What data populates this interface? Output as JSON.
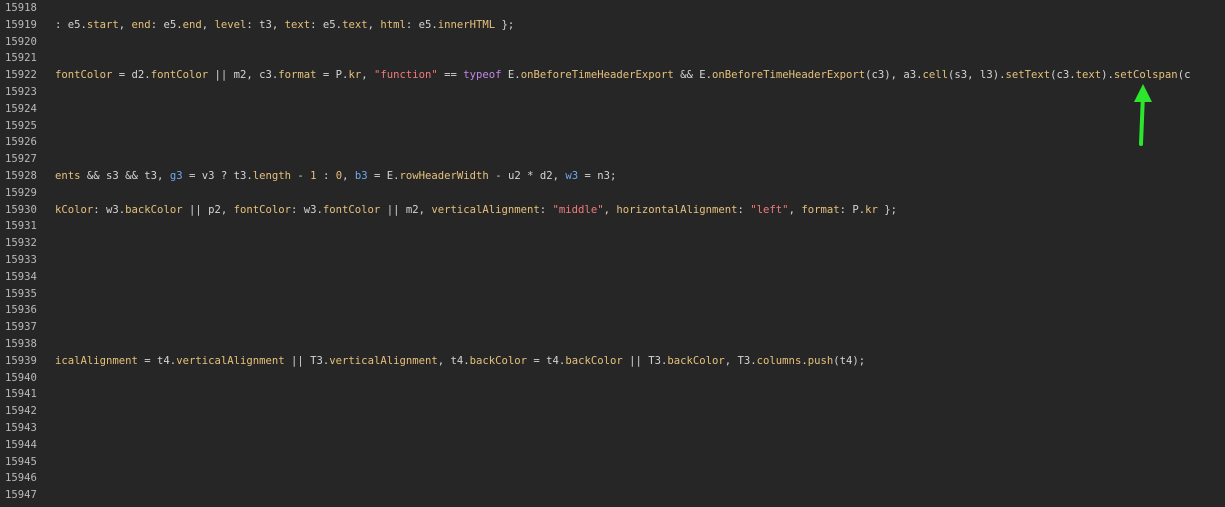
{
  "lines": [
    {
      "no": "15918"
    },
    {
      "no": "15919",
      "t": [
        [
          ": e5.",
          "p"
        ],
        [
          "start",
          "y"
        ],
        [
          ", ",
          "p"
        ],
        [
          "end",
          "y"
        ],
        [
          ": e5.",
          "p"
        ],
        [
          "end",
          "y"
        ],
        [
          ", ",
          "p"
        ],
        [
          "level",
          "y"
        ],
        [
          ": t3, ",
          "p"
        ],
        [
          "text",
          "y"
        ],
        [
          ": e5.",
          "p"
        ],
        [
          "text",
          "y"
        ],
        [
          ", ",
          "p"
        ],
        [
          "html",
          "y"
        ],
        [
          ": e5.",
          "p"
        ],
        [
          "innerHTML",
          "y"
        ],
        [
          " };",
          "p"
        ]
      ]
    },
    {
      "no": "15920"
    },
    {
      "no": "15921"
    },
    {
      "no": "15922",
      "t": [
        [
          "fontColor",
          "y"
        ],
        [
          " = d2.",
          "p"
        ],
        [
          "fontColor",
          "y"
        ],
        [
          " || m2, c3.",
          "p"
        ],
        [
          "format",
          "y"
        ],
        [
          " = P.",
          "p"
        ],
        [
          "kr",
          "y"
        ],
        [
          ", ",
          "p"
        ],
        [
          "\"function\"",
          "s"
        ],
        [
          " == ",
          "p"
        ],
        [
          "typeof",
          "k"
        ],
        [
          " E.",
          "p"
        ],
        [
          "onBeforeTimeHeaderExport",
          "y"
        ],
        [
          " && E.",
          "p"
        ],
        [
          "onBeforeTimeHeaderExport",
          "y"
        ],
        [
          "(c3), a3.",
          "p"
        ],
        [
          "cell",
          "y"
        ],
        [
          "(s3, l3).",
          "p"
        ],
        [
          "setText",
          "y"
        ],
        [
          "(c3.",
          "p"
        ],
        [
          "text",
          "y"
        ],
        [
          ").",
          "p"
        ],
        [
          "setColspan",
          "y"
        ],
        [
          "(c",
          "p"
        ]
      ]
    },
    {
      "no": "15923"
    },
    {
      "no": "15924"
    },
    {
      "no": "15925"
    },
    {
      "no": "15926"
    },
    {
      "no": "15927"
    },
    {
      "no": "15928",
      "t": [
        [
          "ents",
          "y"
        ],
        [
          " && s3 && t3, ",
          "p"
        ],
        [
          "g3",
          "b"
        ],
        [
          " = v3 ? t3.",
          "p"
        ],
        [
          "length",
          "y"
        ],
        [
          " - ",
          "p"
        ],
        [
          "1",
          "y"
        ],
        [
          " : ",
          "p"
        ],
        [
          "0",
          "y"
        ],
        [
          ", ",
          "p"
        ],
        [
          "b3",
          "b"
        ],
        [
          " = E.",
          "p"
        ],
        [
          "rowHeaderWidth",
          "y"
        ],
        [
          " - u2 * d2, ",
          "p"
        ],
        [
          "w3",
          "b"
        ],
        [
          " = n3;",
          "p"
        ]
      ]
    },
    {
      "no": "15929"
    },
    {
      "no": "15930",
      "t": [
        [
          "kColor",
          "y"
        ],
        [
          ": w3.",
          "p"
        ],
        [
          "backColor",
          "y"
        ],
        [
          " || p2, ",
          "p"
        ],
        [
          "fontColor",
          "y"
        ],
        [
          ": w3.",
          "p"
        ],
        [
          "fontColor",
          "y"
        ],
        [
          " || m2, ",
          "p"
        ],
        [
          "verticalAlignment",
          "y"
        ],
        [
          ": ",
          "p"
        ],
        [
          "\"middle\"",
          "s"
        ],
        [
          ", ",
          "p"
        ],
        [
          "horizontalAlignment",
          "y"
        ],
        [
          ": ",
          "p"
        ],
        [
          "\"left\"",
          "s"
        ],
        [
          ", ",
          "p"
        ],
        [
          "format",
          "y"
        ],
        [
          ": P.",
          "p"
        ],
        [
          "kr",
          "y"
        ],
        [
          " };",
          "p"
        ]
      ]
    },
    {
      "no": "15931"
    },
    {
      "no": "15932"
    },
    {
      "no": "15933"
    },
    {
      "no": "15934"
    },
    {
      "no": "15935"
    },
    {
      "no": "15936"
    },
    {
      "no": "15937"
    },
    {
      "no": "15938"
    },
    {
      "no": "15939",
      "t": [
        [
          "icalAlignment",
          "y"
        ],
        [
          " = t4.",
          "p"
        ],
        [
          "verticalAlignment",
          "y"
        ],
        [
          " || T3.",
          "p"
        ],
        [
          "verticalAlignment",
          "y"
        ],
        [
          ", t4.",
          "p"
        ],
        [
          "backColor",
          "y"
        ],
        [
          " = t4.",
          "p"
        ],
        [
          "backColor",
          "y"
        ],
        [
          " || T3.",
          "p"
        ],
        [
          "backColor",
          "y"
        ],
        [
          ", T3.",
          "p"
        ],
        [
          "columns",
          "y"
        ],
        [
          ".",
          "p"
        ],
        [
          "push",
          "y"
        ],
        [
          "(t4);",
          "p"
        ]
      ]
    },
    {
      "no": "15940"
    },
    {
      "no": "15941"
    },
    {
      "no": "15942"
    },
    {
      "no": "15943"
    },
    {
      "no": "15944"
    },
    {
      "no": "15945"
    },
    {
      "no": "15946"
    },
    {
      "no": "15947"
    }
  ],
  "colors": {
    "background": "#262627",
    "line_number": "#b9b9b9",
    "punctuation": "#d4d4d4",
    "property": "#e5c07b",
    "string": "#f07a7a",
    "keyword": "#c586e8",
    "variable_decl": "#6ea8f0",
    "arrow": "#2ee52e"
  },
  "annotation": {
    "icon": "up-arrow-icon"
  }
}
